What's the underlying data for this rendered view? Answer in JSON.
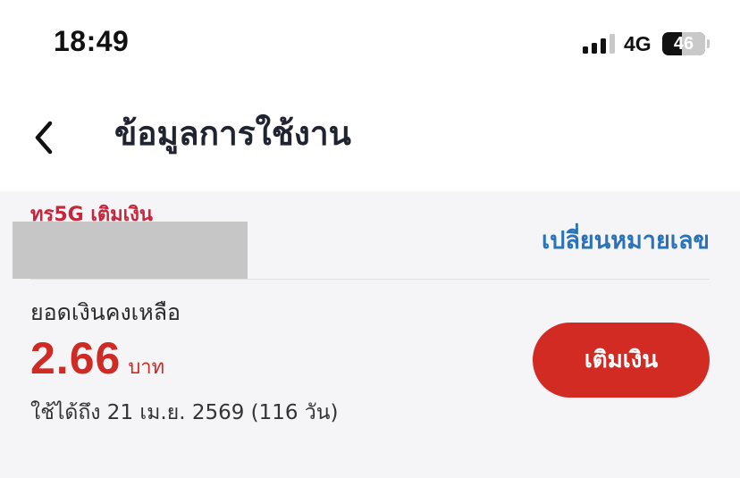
{
  "status_bar": {
    "time": "18:49",
    "network": "4G",
    "battery_percent": "46",
    "battery_level": 0.46,
    "signal_bars": 3
  },
  "header": {
    "back_icon": "chevron-left-icon",
    "title": "ข้อมูลการใช้งาน"
  },
  "account": {
    "plan_name": "ทรู5G เติมเงิน",
    "change_number_label": "เปลี่ยนหมายเลข"
  },
  "balance": {
    "label": "ยอดเงินคงเหลือ",
    "amount": "2.66",
    "unit": "บาท",
    "validity": "ใช้ได้ถึง 21 เม.ย. 2569 (116 วัน)",
    "topup_label": "เติมเงิน"
  },
  "colors": {
    "accent_red": "#cf2a23",
    "plan_red": "#c8253a",
    "link_blue": "#2a73b8",
    "content_background": "#f5f5f8"
  }
}
